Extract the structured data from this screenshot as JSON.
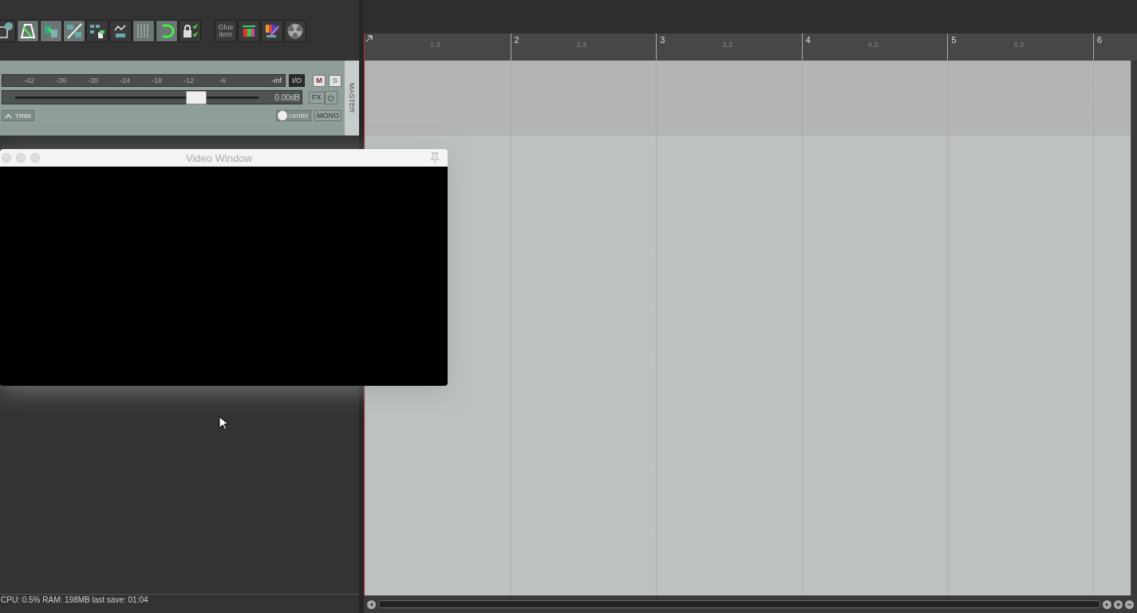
{
  "toolbar": [
    {
      "kind": "icon",
      "on": false
    },
    {
      "kind": "icon",
      "on": true
    },
    {
      "kind": "icon",
      "on": true
    },
    {
      "kind": "icon",
      "on": true
    },
    {
      "kind": "icon",
      "on": false
    },
    {
      "kind": "icon",
      "on": false
    },
    {
      "kind": "icon",
      "on": true
    },
    {
      "kind": "icon",
      "on": true
    },
    {
      "kind": "icon",
      "on": false
    },
    {
      "kind": "text",
      "label": "Glue item",
      "on": false
    },
    {
      "kind": "icon",
      "on": false
    },
    {
      "kind": "icon",
      "on": false
    },
    {
      "kind": "icon",
      "on": false
    }
  ],
  "master": {
    "label": "MASTER",
    "meter_ticks": [
      "-42",
      "-36",
      "-30",
      "-24",
      "-18",
      "-12",
      "-6"
    ],
    "meter_peak": "-inf",
    "io": "I/O",
    "mute": "M",
    "solo": "S",
    "volume": {
      "level": 0.74,
      "reading": "0.00dB"
    },
    "fx": "FX",
    "trim": "TRIM",
    "pan": "center",
    "mono": "MONO"
  },
  "video_window": {
    "title": "Video Window"
  },
  "ruler": {
    "bars": [
      {
        "sub": "1.3"
      },
      {
        "label": "2",
        "sub": "2.3"
      },
      {
        "label": "3",
        "sub": "3.3"
      },
      {
        "label": "4",
        "sub": "4.3"
      },
      {
        "label": "5",
        "sub": "5.3"
      },
      {
        "label": "6"
      }
    ]
  },
  "status_bar": "CPU: 0.5%  RAM: 198MB  last save: 01:04"
}
